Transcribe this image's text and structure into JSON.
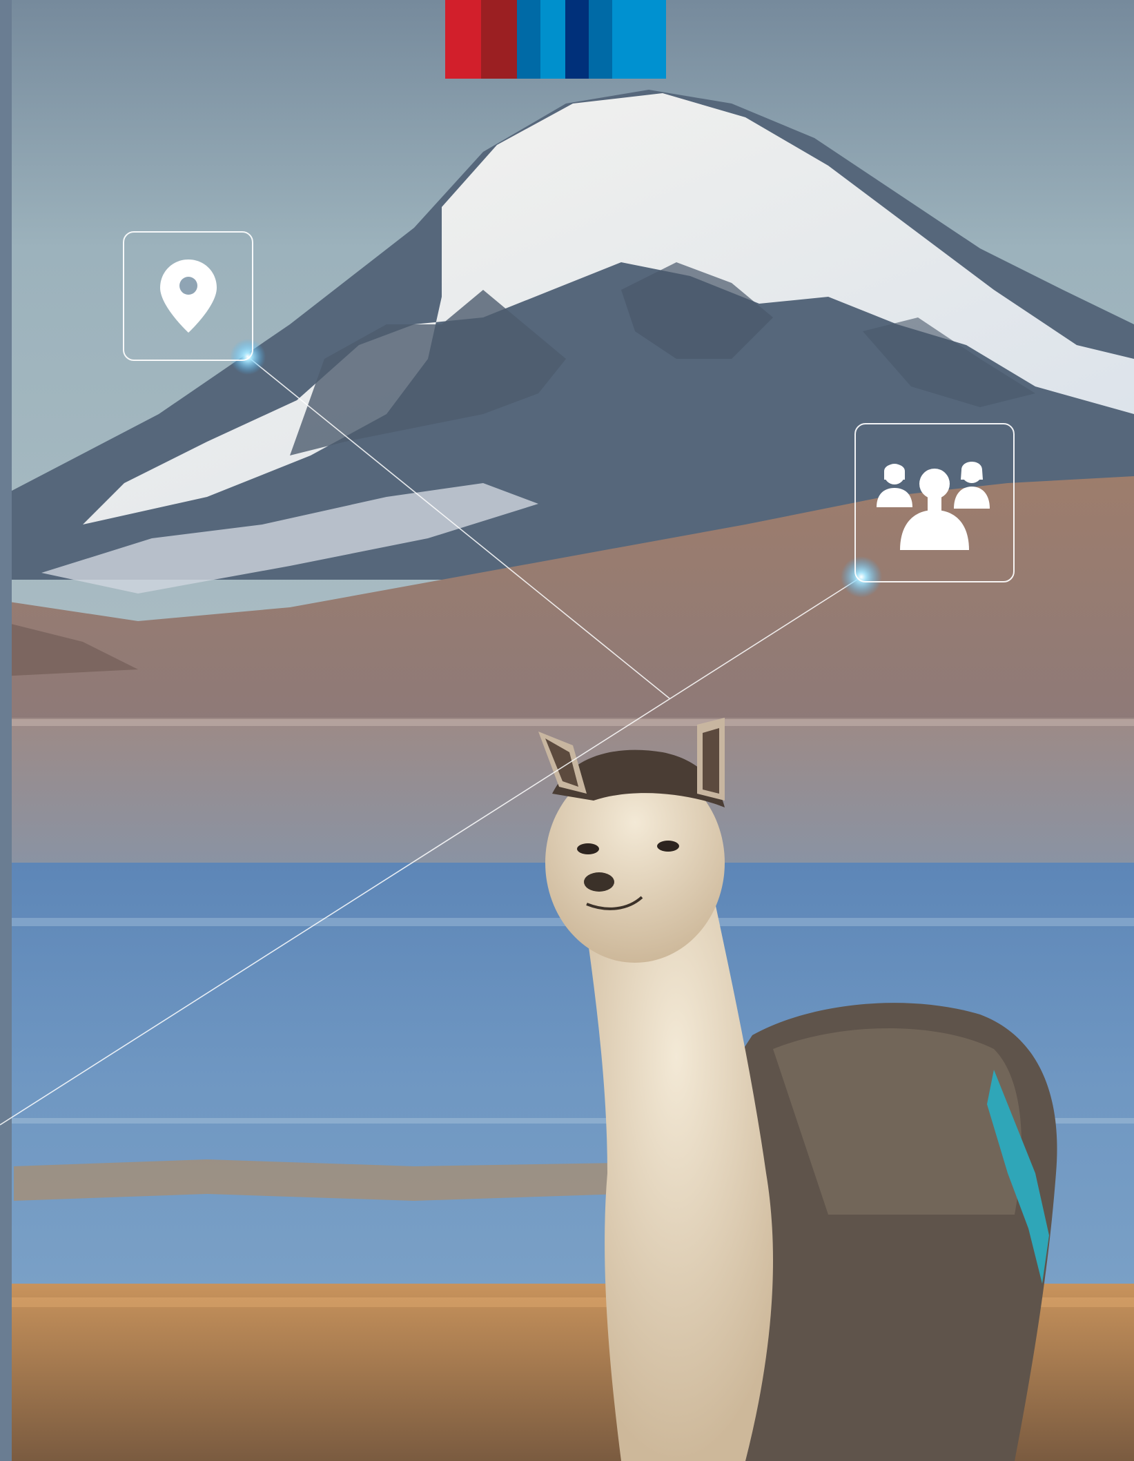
{
  "palette": {
    "sky_top": "#7b8e9e",
    "sky_bottom": "#9db3bd",
    "snow": "#eef1f3",
    "rock": "#4f5d6f",
    "hills": "#8a6f67",
    "lake": "#5f88b5",
    "shore": "#b58a5b",
    "alpaca_light": "#e8dcc4",
    "alpaca_dark": "#5a4e45",
    "tassel": "#2fa6b8",
    "glow": "#7fd4ff",
    "line": "#ffffff"
  },
  "color_bar": [
    "#d21f2b",
    "#9b1f22",
    "#006aa6",
    "#0090cc",
    "#00307a",
    "#006aa6",
    "#0091d0"
  ],
  "callouts": [
    {
      "icon": "map-pin-icon"
    },
    {
      "icon": "group-people-icon"
    }
  ]
}
